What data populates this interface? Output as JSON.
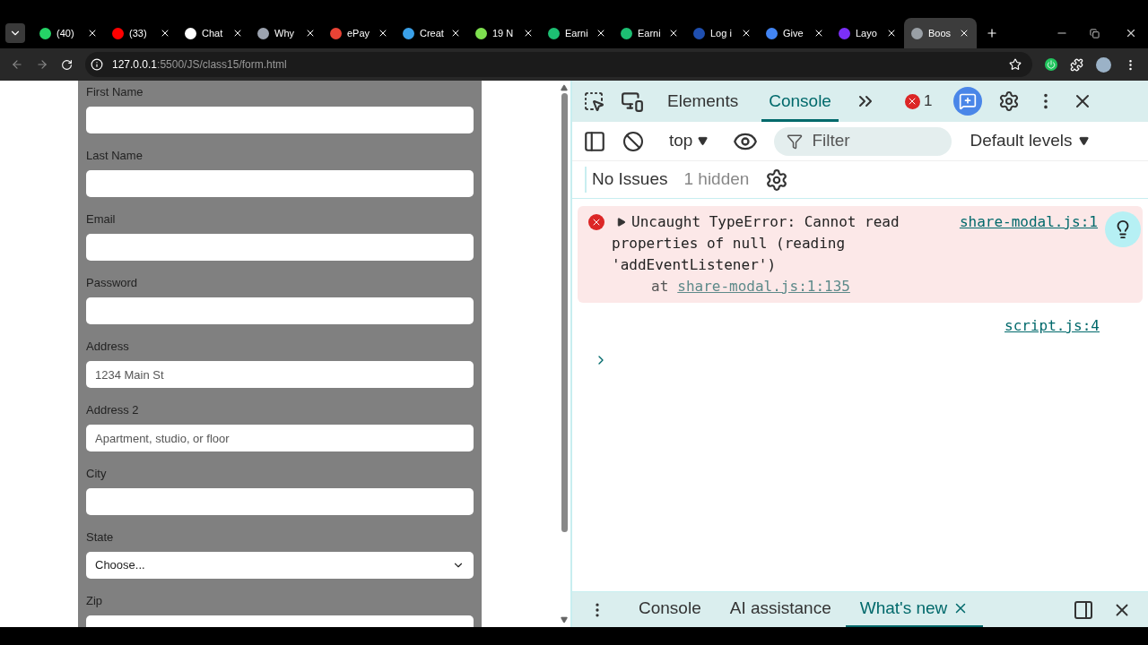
{
  "browser_tabs": [
    {
      "title": "(40)",
      "color": "#25d366",
      "selected": false
    },
    {
      "title": "(33)",
      "color": "#ff0000",
      "selected": false
    },
    {
      "title": "Chat",
      "color": "#ffffff",
      "selected": false
    },
    {
      "title": "Why",
      "color": "#9ca3af",
      "selected": false
    },
    {
      "title": "ePay",
      "color": "#ea4335",
      "selected": false
    },
    {
      "title": "Creat",
      "color": "#3aa0e8",
      "selected": false
    },
    {
      "title": "19 N",
      "color": "#7ee04f",
      "selected": false
    },
    {
      "title": "Earni",
      "color": "#1dbf73",
      "selected": false
    },
    {
      "title": "Earni",
      "color": "#1dbf73",
      "selected": false
    },
    {
      "title": "Log i",
      "color": "#1f4fb0",
      "selected": false
    },
    {
      "title": "Give",
      "color": "#4285f4",
      "selected": false
    },
    {
      "title": "Layo",
      "color": "#7b2ff7",
      "selected": false
    },
    {
      "title": "Boos",
      "color": "#9aa0a6",
      "selected": true
    }
  ],
  "address": {
    "host": "127.0.0.1",
    "path": ":5500/JS/class15/form.html"
  },
  "form": {
    "fields": [
      {
        "label": "First Name",
        "kind": "text"
      },
      {
        "label": "Last Name",
        "kind": "text"
      },
      {
        "label": "Email",
        "kind": "text"
      },
      {
        "label": "Password",
        "kind": "text"
      },
      {
        "label": "Address",
        "kind": "text",
        "placeholder": "1234 Main St"
      },
      {
        "label": "Address 2",
        "kind": "text",
        "placeholder": "Apartment, studio, or floor"
      },
      {
        "label": "City",
        "kind": "text"
      },
      {
        "label": "State",
        "kind": "select",
        "value": "Choose..."
      },
      {
        "label": "Zip",
        "kind": "text"
      }
    ]
  },
  "devtools": {
    "tabs": [
      {
        "label": "Elements",
        "selected": false
      },
      {
        "label": "Console",
        "selected": true
      }
    ],
    "error_count": "1",
    "context": "top",
    "filter_placeholder": "Filter",
    "levels": "Default levels",
    "issues": "No Issues",
    "hidden": "1 hidden",
    "messages": [
      {
        "kind": "error",
        "text": "Uncaught TypeError: Cannot read properties of null (reading 'addEventListener')",
        "at": "at",
        "at_link": "share-modal.js:1:135",
        "source": "share-modal.js:1"
      },
      {
        "kind": "log",
        "source": "script.js:4"
      }
    ],
    "drawer_tabs": [
      {
        "label": "Console",
        "selected": false
      },
      {
        "label": "AI assistance",
        "selected": false
      },
      {
        "label": "What's new",
        "selected": true
      }
    ]
  }
}
